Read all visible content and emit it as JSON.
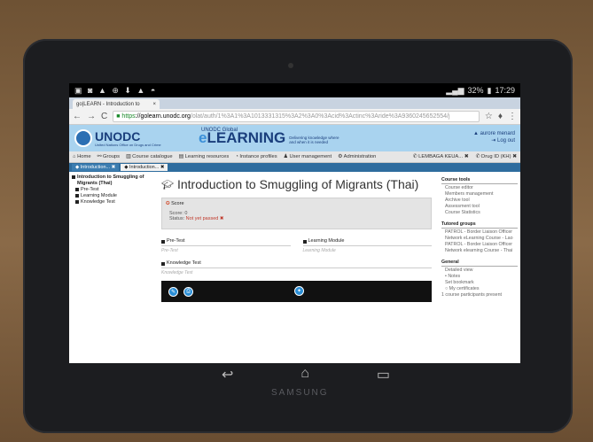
{
  "status_bar": {
    "left_icons": "▣ ◙ ▲ ⊕ ⬇ ▲ ◓",
    "battery": "32%",
    "time": "17:29"
  },
  "browser": {
    "tab_title": "go|LEARN - Introduction to",
    "tab_close": "×",
    "url_https": "https",
    "url_host": "://golearn.unodc.org",
    "url_path": "/olat/auth/1%3A1%3A1013331315%3A2%3A0%3Acid%3Actinc%3Aride%3A9360245652554/j",
    "icons": {
      "back": "←",
      "forward": "→",
      "reload": "C",
      "star": "☆",
      "mic": "♦",
      "menu": "⋮"
    }
  },
  "banner": {
    "org": "UNODC",
    "org_sub": "United Nations Office on Drugs and Crime",
    "global": "UNODC Global",
    "elearning_e": "e",
    "elearning_rest": "LEARNING",
    "tagline": "Delivering knowledge where and when it is needed",
    "user_name": "▲ aurore menard",
    "logout": "⇥ Log out"
  },
  "main_nav": {
    "items": [
      "⌂ Home",
      "⚯ Groups",
      "▥ Course catalogue",
      "▤ Learning resources",
      "◔ Instance profiles",
      "♟ User management",
      "⚙ Administration"
    ],
    "right": [
      "✆ LEMBAGA KEUA... ✖",
      "✆ Drug ID (KH) ✖"
    ]
  },
  "tool_tabs": [
    {
      "label": "◆ Introduction... ✖"
    },
    {
      "label": "◆ Introduction... ✖"
    }
  ],
  "left_nav": {
    "course": "Introduction to Smuggling of Migrants (Thai)",
    "items": [
      "Pre-Test",
      "Learning Module",
      "Knowledge Test"
    ]
  },
  "main": {
    "title": "Introduction to Smuggling of Migrants (Thai)",
    "score_heading": "Score",
    "score_line": "Score: 0",
    "status_label": "Status:",
    "status_value": "Not yet passed",
    "cards": [
      {
        "title": "Pre-Test",
        "sub": "Pre-Test"
      },
      {
        "title": "Learning Module",
        "sub": "Learning Module"
      },
      {
        "title": "Knowledge Test",
        "sub": "Knowledge Test"
      }
    ]
  },
  "course_tools": {
    "heading": "Course tools",
    "items": [
      "Course editor",
      "Members management",
      "Archive tool",
      "Assessment tool",
      "Course Statistics"
    ]
  },
  "tutored_groups": {
    "heading": "Tutored groups",
    "items": [
      "PATROL - Border Liaison Officer",
      "Network eLearning Course - Lao",
      "PATROL - Border Liaison Officer",
      "Network elearning Course - Thai"
    ]
  },
  "general": {
    "heading": "General",
    "items": [
      "Detailed view",
      "• Notes",
      "Set bookmark",
      "○ My certificates",
      "1 course participants present"
    ]
  },
  "device": {
    "brand": "SAMSUNG",
    "softkeys": [
      "↩",
      "⌂",
      "▭"
    ]
  }
}
